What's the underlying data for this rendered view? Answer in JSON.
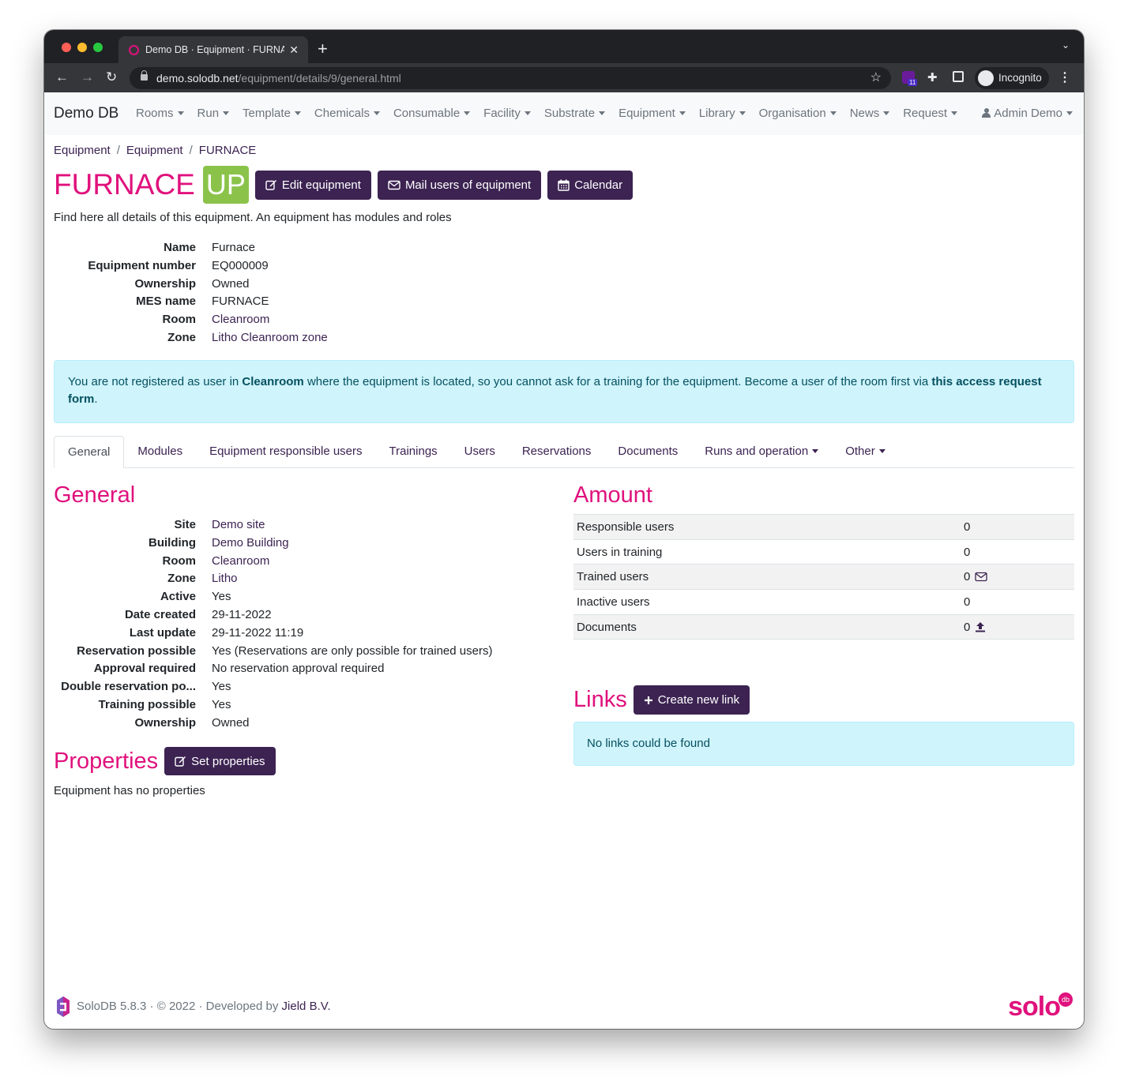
{
  "browser": {
    "tab_title": "Demo DB · Equipment · FURNACE",
    "url_host": "demo.solodb.net",
    "url_path": "/equipment/details/9/general.html",
    "extension_count": "11",
    "incognito_label": "Incognito"
  },
  "navbar": {
    "brand": "Demo DB",
    "menu": [
      "Rooms",
      "Run",
      "Template",
      "Chemicals",
      "Consumable",
      "Facility",
      "Substrate",
      "Equipment",
      "Library",
      "Organisation",
      "News",
      "Request"
    ],
    "user": "Admin Demo"
  },
  "breadcrumb": [
    "Equipment",
    "Equipment",
    "FURNACE"
  ],
  "page": {
    "title": "FURNACE",
    "status": "UP",
    "status_color": "#8bc34a",
    "buttons": {
      "edit": "Edit equipment",
      "mail": "Mail users of equipment",
      "calendar": "Calendar"
    },
    "intro": "Find here all details of this equipment. An equipment has modules and roles"
  },
  "details": [
    {
      "label": "Name",
      "value": "Furnace"
    },
    {
      "label": "Equipment number",
      "value": "EQ000009"
    },
    {
      "label": "Ownership",
      "value": "Owned"
    },
    {
      "label": "MES name",
      "value": "FURNACE"
    },
    {
      "label": "Room",
      "value": "Cleanroom"
    },
    {
      "label": "Zone",
      "value": "Litho Cleanroom zone"
    }
  ],
  "alert": {
    "part1": "You are not registered as user in ",
    "room": "Cleanroom",
    "part2": " where the equipment is located, so you cannot ask for a training for the equipment. Become a user of the room first via ",
    "link": "this access request form",
    "part3": "."
  },
  "tabs": [
    "General",
    "Modules",
    "Equipment responsible users",
    "Trainings",
    "Users",
    "Reservations",
    "Documents",
    "Runs and operation",
    "Other"
  ],
  "general": {
    "title": "General",
    "rows": [
      {
        "label": "Site",
        "value": "Demo site"
      },
      {
        "label": "Building",
        "value": "Demo Building"
      },
      {
        "label": "Room",
        "value": "Cleanroom"
      },
      {
        "label": "Zone",
        "value": "Litho"
      },
      {
        "label": "Active",
        "value": "Yes"
      },
      {
        "label": "Date created",
        "value": "29-11-2022"
      },
      {
        "label": "Last update",
        "value": "29-11-2022 11:19"
      },
      {
        "label": "Reservation possible",
        "value": "Yes (Reservations are only possible for trained users)"
      },
      {
        "label": "Approval required",
        "value": "No reservation approval required"
      },
      {
        "label": "Double reservation po...",
        "value": "Yes"
      },
      {
        "label": "Training possible",
        "value": "Yes"
      },
      {
        "label": "Ownership",
        "value": "Owned"
      }
    ]
  },
  "properties": {
    "title": "Properties",
    "button": "Set properties",
    "empty": "Equipment has no properties"
  },
  "amount": {
    "title": "Amount",
    "rows": [
      {
        "label": "Responsible users",
        "value": "0"
      },
      {
        "label": "Users in training",
        "value": "0"
      },
      {
        "label": "Trained users",
        "value": "0"
      },
      {
        "label": "Inactive users",
        "value": "0"
      },
      {
        "label": "Documents",
        "value": "0"
      }
    ]
  },
  "links": {
    "title": "Links",
    "button": "Create new link",
    "empty": "No links could be found"
  },
  "footer": {
    "version": "SoloDB 5.8.3 · © 2022 · Developed by ",
    "developer": "Jield B.V.",
    "logo_text": "solo",
    "logo_badge": "db"
  }
}
